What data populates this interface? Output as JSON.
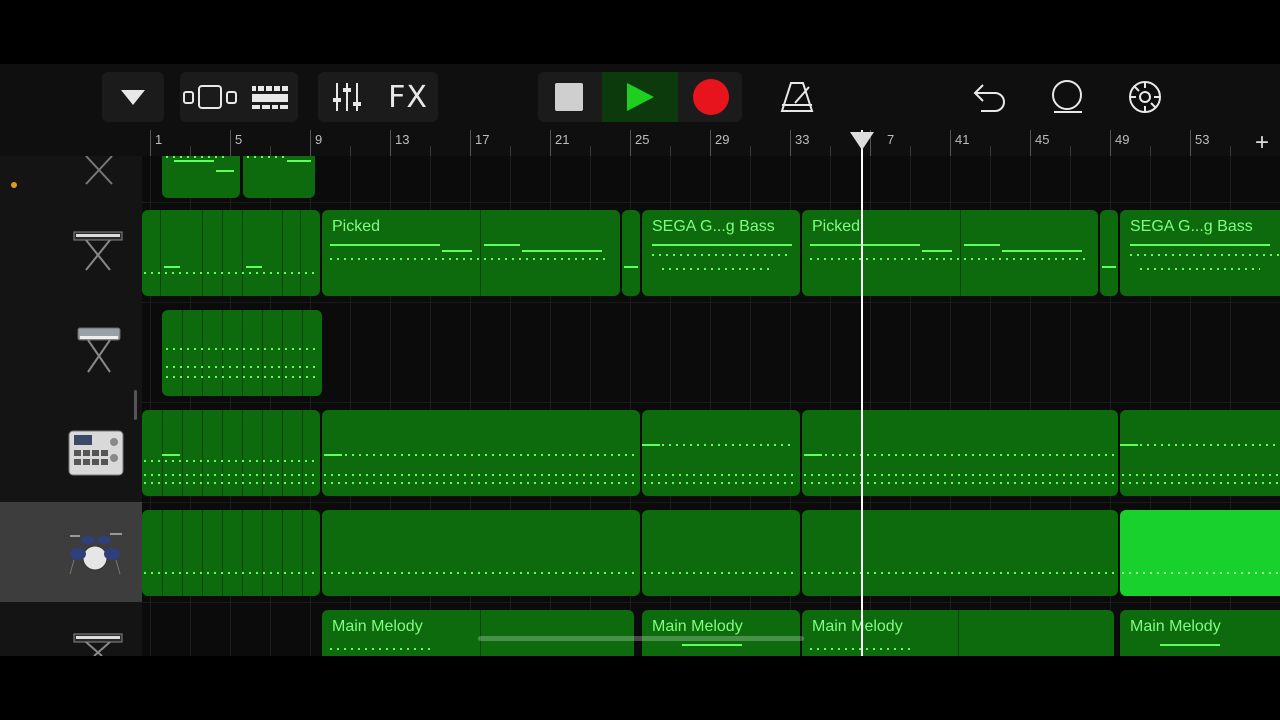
{
  "toolbar": {
    "fx_label": "FX",
    "add_track_label": "+"
  },
  "ruler": {
    "bar_numbers": [
      "1",
      "5",
      "9",
      "13",
      "17",
      "21",
      "25",
      "29",
      "33",
      "37",
      "41",
      "45",
      "49",
      "53"
    ]
  },
  "playhead": {
    "bar_label": "37"
  },
  "tracks": [
    {
      "instrument": "keyboard",
      "state": "partial-top",
      "has_dot": true
    },
    {
      "instrument": "keyboard-stand"
    },
    {
      "instrument": "synth-keyboard"
    },
    {
      "instrument": "drum-machine"
    },
    {
      "instrument": "drum-kit",
      "selected": true
    },
    {
      "instrument": "keyboard-stand"
    }
  ],
  "regions": {
    "picked_1": "Picked",
    "sega_1": "SEGA G...g Bass",
    "picked_2": "Picked",
    "sega_2": "SEGA G...g Bass",
    "melody_1": "Main Melody",
    "melody_2": "Main Melody",
    "melody_3": "Main Melody",
    "melody_4": "Main Melody"
  },
  "colors": {
    "region": "#0d6b0d",
    "region_selected": "#18d12c",
    "note": "#5cff5c",
    "play_button": "#1fcf1f",
    "record_button": "#e8141d",
    "track_dot": "#e39a1b"
  }
}
